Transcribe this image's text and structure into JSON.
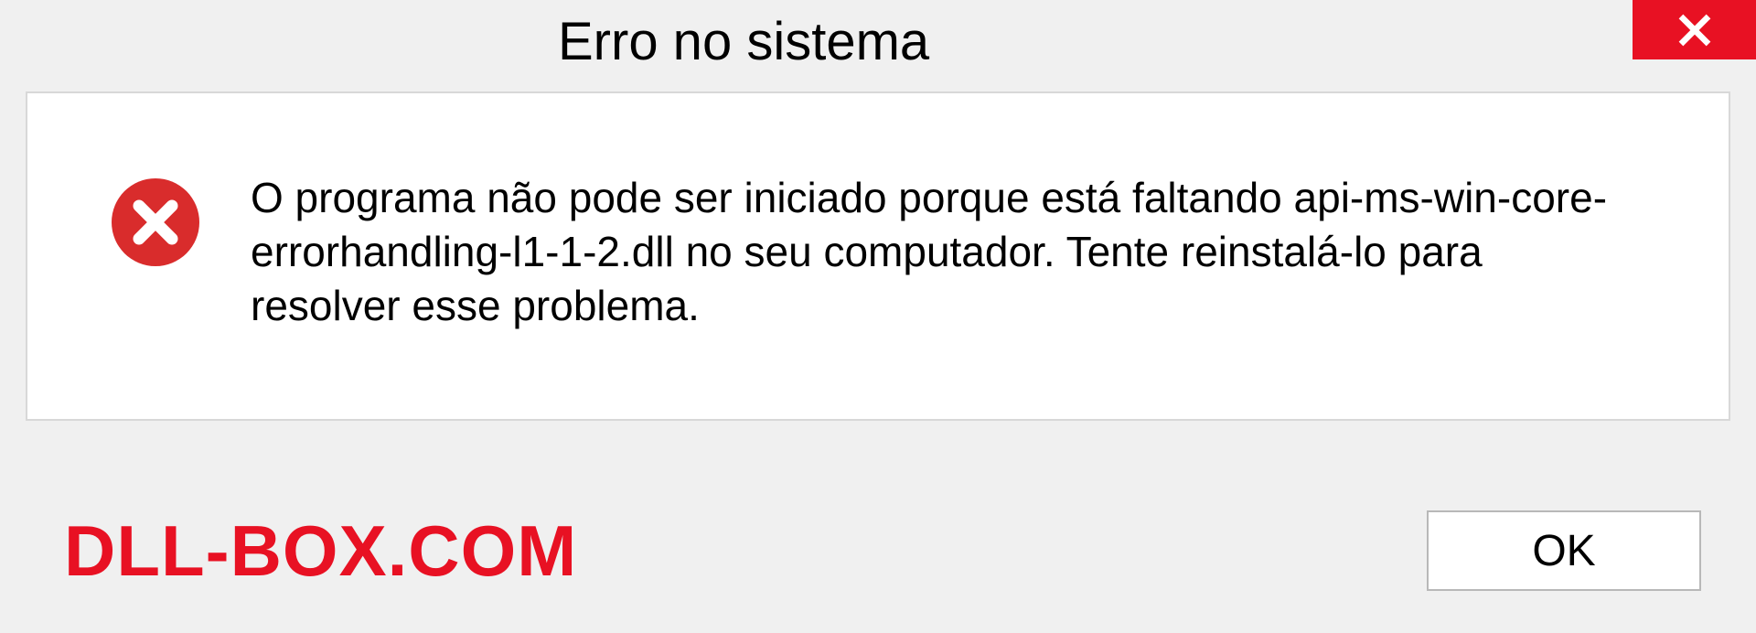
{
  "dialog": {
    "title": "Erro no sistema",
    "message": "O programa não pode ser iniciado porque está faltando api-ms-win-core-errorhandling-l1-1-2.dll no seu computador. Tente reinstalá-lo para resolver esse problema.",
    "ok_label": "OK"
  },
  "watermark": {
    "text": "DLL-BOX.COM"
  },
  "colors": {
    "close_bg": "#e81123",
    "error_icon": "#d92c2c",
    "watermark": "#e81123"
  }
}
